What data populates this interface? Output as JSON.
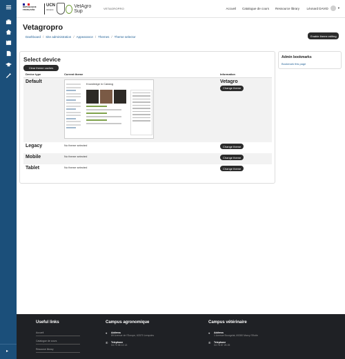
{
  "nav": {
    "brand": "VETAGROPRO",
    "gouv_text": "RÉPUBLIQUE FRANÇAISE",
    "ucn_big": "UCN",
    "ucn_small": "campus",
    "vetagro_logo": "VetAgro Sup",
    "links": [
      "Accueil",
      "Catalogue de cours",
      "Ressource library"
    ],
    "user": "Léonard DAVID"
  },
  "rail_icons": [
    "menu-icon",
    "dashboard-icon",
    "home-icon",
    "calendar-icon",
    "files-icon",
    "graduation-icon",
    "wrench-icon"
  ],
  "page": {
    "title": "Vetagropro",
    "breadcrumbs": [
      "Dashboard",
      "Site administration",
      "Appearance",
      "Themes",
      "Theme selector"
    ],
    "enable_button": "Enable theme editing"
  },
  "selector": {
    "heading": "Select device",
    "clear_button": "Clear theme caches",
    "columns": [
      "Device type",
      "Current theme",
      "Information"
    ],
    "rows": [
      {
        "device": "Default",
        "current": "",
        "info_name": "Vetagro",
        "button": "Change theme",
        "has_screenshot": true,
        "screenshot_title": "Knowledge in Catalog"
      },
      {
        "device": "Legacy",
        "current": "No theme selected",
        "info_name": "",
        "button": "Change theme",
        "has_screenshot": false
      },
      {
        "device": "Mobile",
        "current": "No theme selected",
        "info_name": "",
        "button": "Change theme",
        "has_screenshot": false
      },
      {
        "device": "Tablet",
        "current": "No theme selected",
        "info_name": "",
        "button": "Change theme",
        "has_screenshot": false
      }
    ]
  },
  "bookmarks": {
    "title": "Admin bookmarks",
    "link": "Bookmark this page"
  },
  "footer": {
    "useful_links": {
      "title": "Useful links",
      "items": [
        "Accueil",
        "Catalogue de cours",
        "Resource library"
      ]
    },
    "campus_agro": {
      "title": "Campus agronomique",
      "address_label": "Address",
      "address": "89 Avenue de l'Europe, 63370 Lempdes",
      "phone_label": "Telephone",
      "phone": "04 73 98 13 13"
    },
    "campus_vet": {
      "title": "Campus vétérinaire",
      "address_label": "Address",
      "address": "1 Avenue Bourgelat, 69280 Marcy l'Etoile",
      "phone_label": "Telephone",
      "phone": "04 78 87 25 25"
    }
  }
}
